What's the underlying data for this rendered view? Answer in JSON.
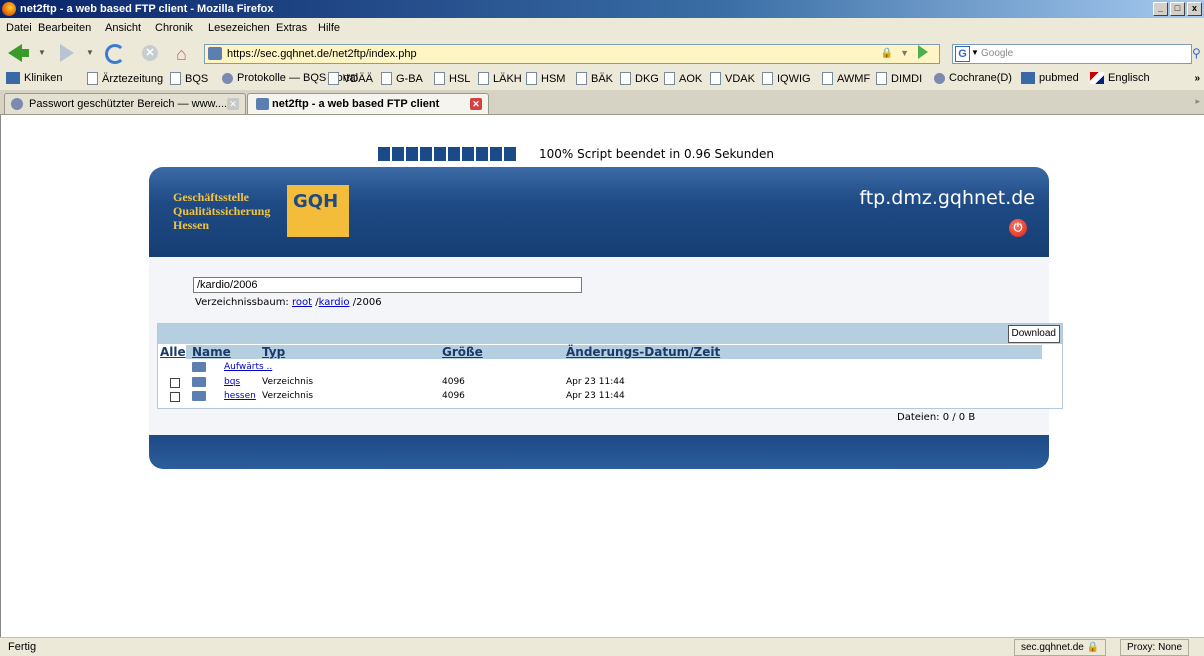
{
  "window": {
    "title": "net2ftp - a web based FTP client - Mozilla Firefox",
    "buttons": [
      "_",
      "□",
      "x"
    ]
  },
  "menu": [
    "Datei",
    "Bearbeiten",
    "Ansicht",
    "Chronik",
    "Lesezeichen",
    "Extras",
    "Hilfe"
  ],
  "navbar": {
    "url": "https://sec.gqhnet.de/net2ftp/index.php",
    "search_placeholder": "Google"
  },
  "bookmarks": [
    {
      "label": "Kliniken",
      "icon": "kliniken-icon"
    },
    {
      "label": "Ärztezeitung",
      "icon": "page-icon"
    },
    {
      "label": "BQS",
      "icon": "page-icon"
    },
    {
      "label": "Protokolle — BQS Portal",
      "icon": "globe-icon"
    },
    {
      "label": "VDÄÄ",
      "icon": "page-icon"
    },
    {
      "label": "G-BA",
      "icon": "page-icon"
    },
    {
      "label": "HSL",
      "icon": "page-icon"
    },
    {
      "label": "LÄKH",
      "icon": "page-icon"
    },
    {
      "label": "HSM",
      "icon": "page-icon"
    },
    {
      "label": "BÄK",
      "icon": "page-icon"
    },
    {
      "label": "DKG",
      "icon": "page-icon"
    },
    {
      "label": "AOK",
      "icon": "page-icon"
    },
    {
      "label": "VDAK",
      "icon": "page-icon"
    },
    {
      "label": "IQWIG",
      "icon": "page-icon"
    },
    {
      "label": "AWMF",
      "icon": "page-icon"
    },
    {
      "label": "DIMDI",
      "icon": "page-icon"
    },
    {
      "label": "Cochrane(D)",
      "icon": "globe-icon"
    },
    {
      "label": "pubmed",
      "icon": "pubmed-icon"
    },
    {
      "label": "Englisch",
      "icon": "flag-icon"
    }
  ],
  "bookmarks_more": "»",
  "tabs": [
    {
      "label": "Passwort geschützter Bereich — www....",
      "active": false
    },
    {
      "label": "net2ftp - a web based FTP client",
      "active": true
    }
  ],
  "progress": {
    "text": "100% Script beendet in 0.96 Sekunden",
    "percent": 100
  },
  "logo": {
    "line1": "Geschäftsstelle",
    "line2": "Qualitätssicherung",
    "line3": "Hessen",
    "mark": "GQH"
  },
  "host": "ftp.dmz.gqhnet.de",
  "directory": "/kardio/2006",
  "breadcrumb": {
    "label": "Verzeichnissbaum:",
    "root": "root",
    "sep1": "/",
    "kardio": "kardio",
    "rest": "/2006"
  },
  "list": {
    "download_label": "Download",
    "columns": {
      "all": "Alle",
      "name": "Name",
      "type": "Typ",
      "size": "Größe",
      "date": "Änderungs-Datum/Zeit"
    },
    "up_label": "Aufwärts ..",
    "rows": [
      {
        "name": "bqs",
        "type": "Verzeichnis",
        "size": "4096",
        "date": "Apr 23 11:44"
      },
      {
        "name": "hessen",
        "type": "Verzeichnis",
        "size": "4096",
        "date": "Apr 23 11:44"
      }
    ],
    "files_count": "Dateien: 0 / 0 B"
  },
  "status": {
    "text": "Fertig",
    "host": "sec.gqhnet.de",
    "proxy": "Proxy: None"
  }
}
